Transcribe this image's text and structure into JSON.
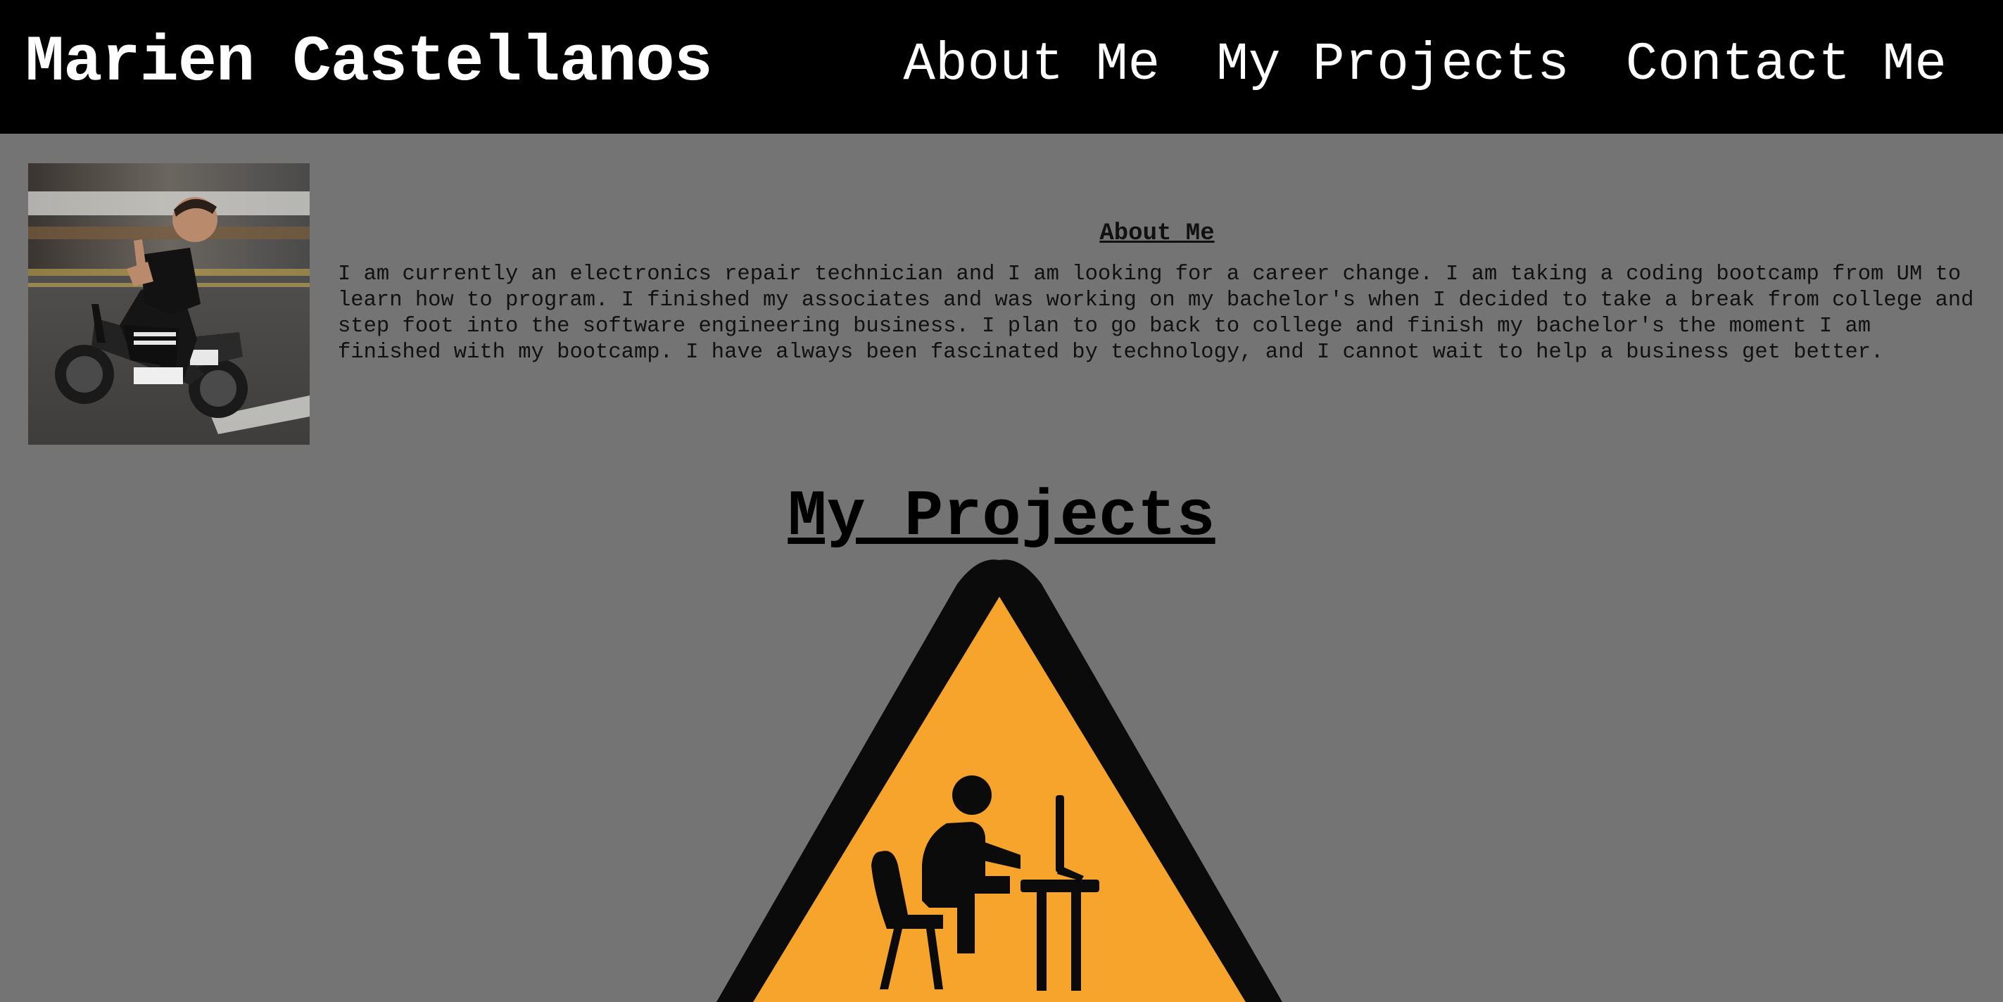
{
  "header": {
    "site_title": "Marien Castellanos",
    "nav": [
      {
        "label": "About Me"
      },
      {
        "label": "My Projects"
      },
      {
        "label": "Contact Me"
      }
    ]
  },
  "about": {
    "heading": "About Me",
    "text": "I am currently an electronics repair technician and I am looking for a career change. I am taking a coding bootcamp from UM to learn how to program. I finished my associates and was working on my bachelor's when I decided to take a break from college and step foot into the software engineering business. I plan to go back to college and finish my bachelor's the moment I am finished with my bootcamp. I have always been fascinated by technology, and I cannot wait to help a business get better.",
    "photo_icon": "profile-photo-person-on-minibike"
  },
  "projects": {
    "heading": "My Projects",
    "sign_icon": "under-construction-warning-sign"
  },
  "colors": {
    "header_bg": "#000000",
    "page_bg": "#747474",
    "sign_fill": "#f7a42c",
    "sign_border": "#0b0b0b"
  }
}
